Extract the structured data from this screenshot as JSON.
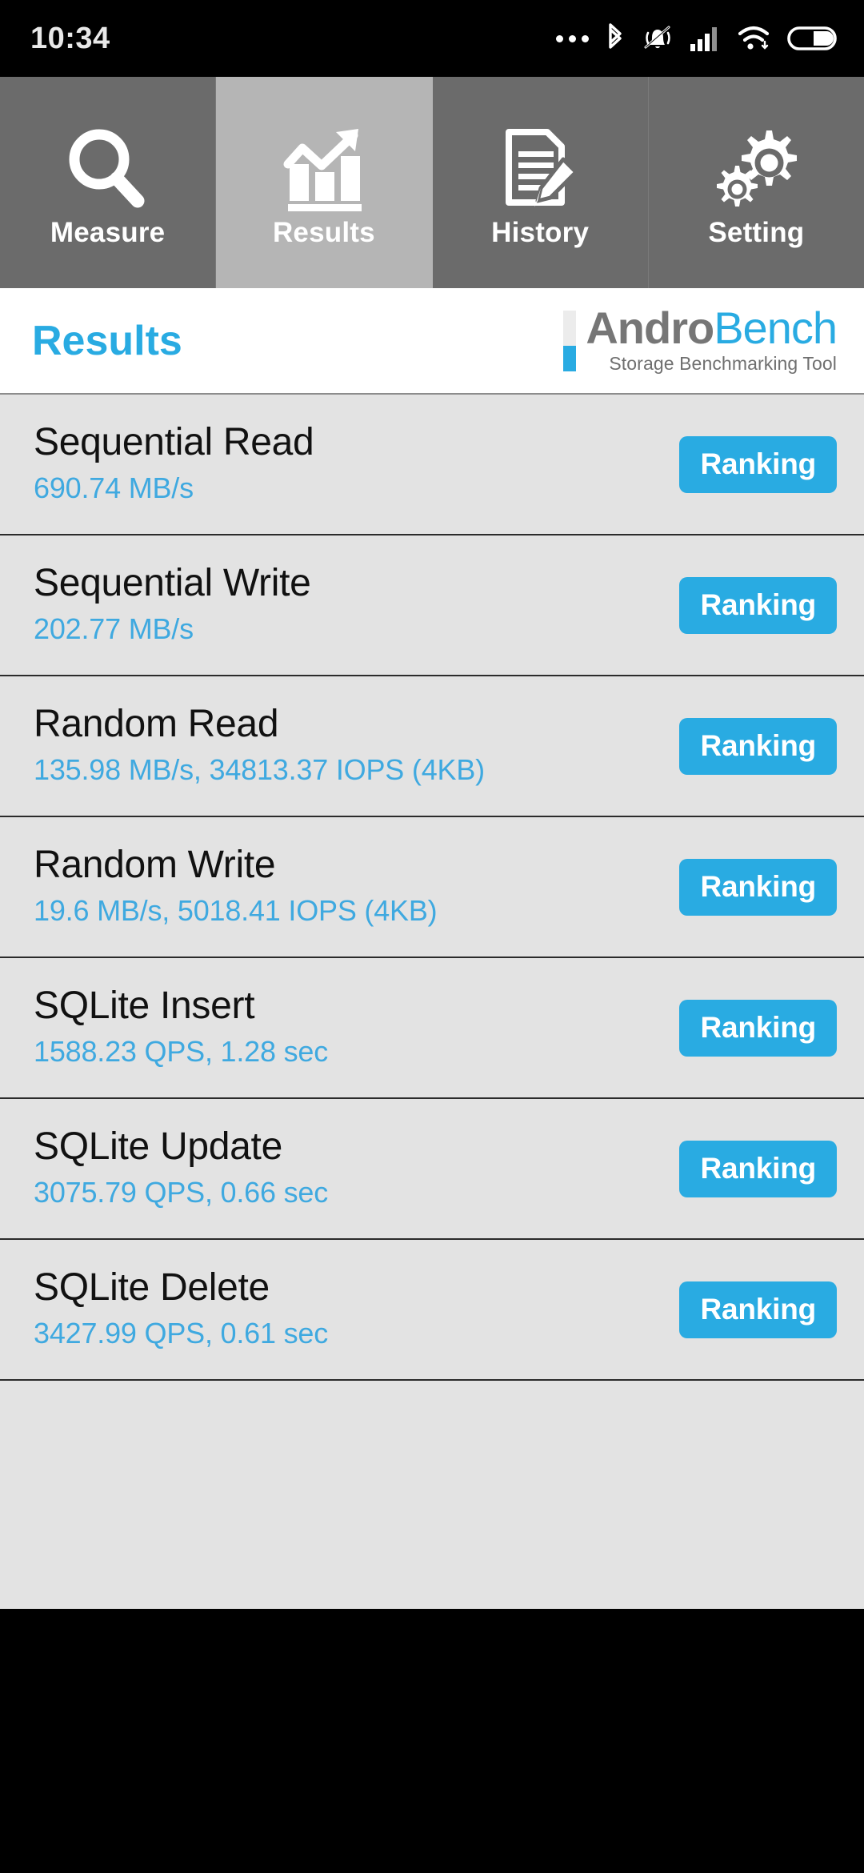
{
  "statusbar": {
    "time": "10:34",
    "icons": [
      {
        "name": "more-dots-icon",
        "glyph": "•••"
      },
      {
        "name": "bluetooth-icon",
        "glyph": "bluetooth"
      },
      {
        "name": "notifications-muted-icon",
        "glyph": "bell-slash"
      },
      {
        "name": "cellular-signal-icon",
        "glyph": "signal-bars"
      },
      {
        "name": "wifi-icon",
        "glyph": "wifi"
      },
      {
        "name": "battery-icon",
        "glyph": "battery-half"
      }
    ]
  },
  "tabs": [
    {
      "label": "Measure",
      "icon": "magnifier-icon",
      "active": false
    },
    {
      "label": "Results",
      "icon": "bar-chart-arrow-icon",
      "active": true
    },
    {
      "label": "History",
      "icon": "document-pencil-icon",
      "active": false
    },
    {
      "label": "Setting",
      "icon": "gears-icon",
      "active": false
    }
  ],
  "header": {
    "title": "Results",
    "logo_primary": "Andro",
    "logo_secondary": "Bench",
    "logo_tagline": "Storage Benchmarking Tool"
  },
  "results": {
    "button_label": "Ranking",
    "rows": [
      {
        "title": "Sequential Read",
        "value": "690.74 MB/s"
      },
      {
        "title": "Sequential Write",
        "value": "202.77 MB/s"
      },
      {
        "title": "Random Read",
        "value": "135.98 MB/s, 34813.37 IOPS (4KB)"
      },
      {
        "title": "Random Write",
        "value": "19.6 MB/s, 5018.41 IOPS (4KB)"
      },
      {
        "title": "SQLite Insert",
        "value": "1588.23 QPS, 1.28 sec"
      },
      {
        "title": "SQLite Update",
        "value": "3075.79 QPS, 0.66 sec"
      },
      {
        "title": "SQLite Delete",
        "value": "3427.99 QPS, 0.61 sec"
      }
    ]
  },
  "colors": {
    "accent_blue": "#29ABE2",
    "value_blue": "#3fa9e0",
    "tab_inactive": "#6b6b6b",
    "tab_active": "#b5b5b5",
    "list_background": "#e3e3e3",
    "logo_gray": "#767676"
  }
}
